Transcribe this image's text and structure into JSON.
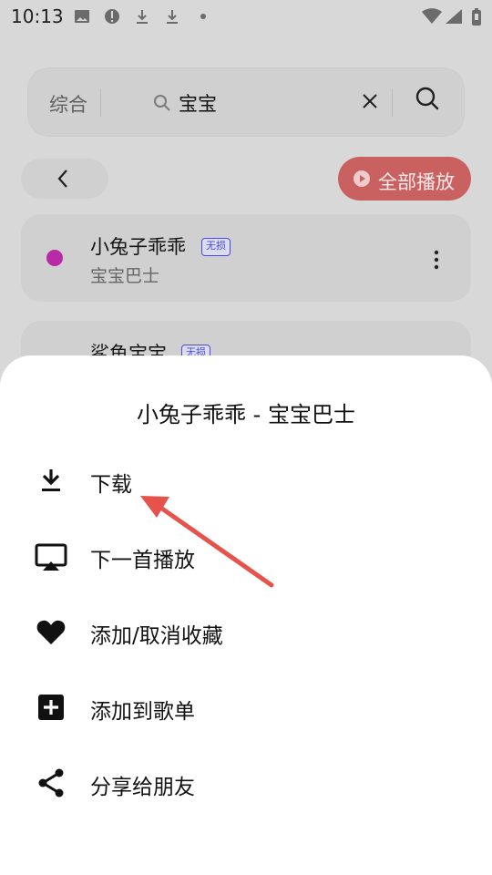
{
  "status_bar": {
    "time": "10:13"
  },
  "search": {
    "category": "综合",
    "query": "宝宝"
  },
  "header": {
    "play_all_label": "全部播放"
  },
  "songs": [
    {
      "title": "小兔子乖乖",
      "badge": "无损",
      "artist": "宝宝巴士"
    },
    {
      "title": "鲨鱼宝宝",
      "badge": "无损",
      "artist": ""
    }
  ],
  "sheet": {
    "title": "小兔子乖乖 - 宝宝巴士",
    "items": [
      {
        "label": "下载",
        "icon": "download-icon"
      },
      {
        "label": "下一首播放",
        "icon": "cast-icon"
      },
      {
        "label": "添加/取消收藏",
        "icon": "heart-icon"
      },
      {
        "label": "添加到歌单",
        "icon": "add-box-icon"
      },
      {
        "label": "分享给朋友",
        "icon": "share-icon"
      }
    ]
  },
  "colors": {
    "accent": "#C96161",
    "song_dot": "#B92AA6",
    "annotation_arrow": "#E5534B"
  }
}
